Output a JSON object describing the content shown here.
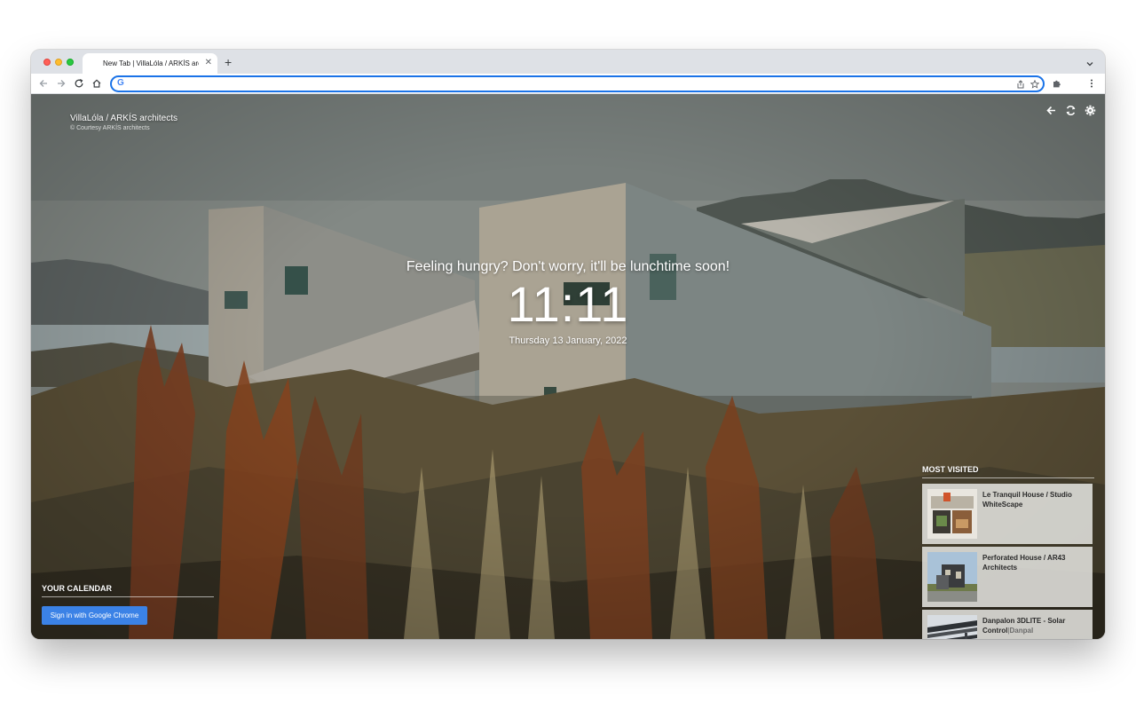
{
  "browser": {
    "tab_title": "New Tab | VillaLóla / ARKÍS architects",
    "tab_close": "✕",
    "new_tab": "+",
    "omnibox_value": ""
  },
  "photo": {
    "title": "VillaLóla / ARKÍS architects",
    "credit": "© Courtesy ARKÍS architects"
  },
  "greeting": "Feeling hungry? Don't worry, it'll be lunchtime soon!",
  "clock": "11:11",
  "date": "Thursday 13 January, 2022",
  "calendar": {
    "title": "YOUR CALENDAR",
    "signin_label": "Sign in with Google Chrome"
  },
  "most_visited": {
    "title": "MOST VISITED",
    "items": [
      {
        "title": "Le Tranquil House / Studio WhiteScape"
      },
      {
        "title": "Perforated House / AR43 Architects"
      },
      {
        "title": "Danpalon 3DLITE - Solar Control",
        "separator": "|",
        "source": "Danpal"
      }
    ]
  },
  "colors": {
    "accent": "#1a73e8",
    "signin_button": "#3b82e6"
  }
}
